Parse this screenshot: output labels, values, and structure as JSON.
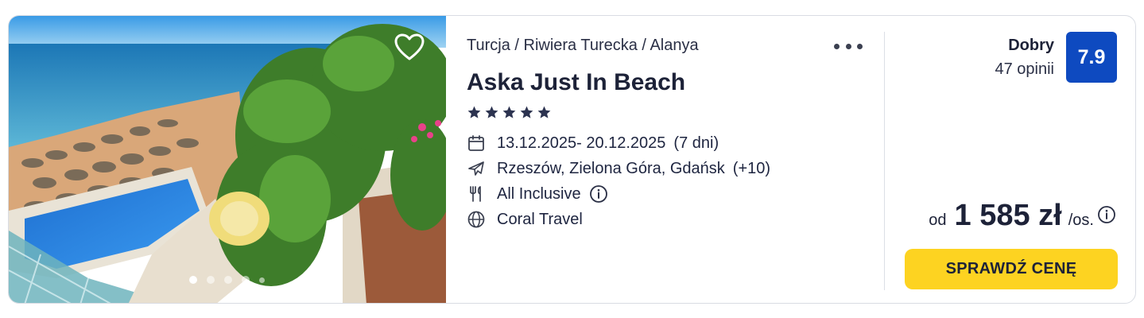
{
  "listing": {
    "breadcrumb": "Turcja / Riwiera Turecka / Alanya",
    "hotel_name": "Aska Just In Beach",
    "star_rating": 5,
    "dates": "13.12.2025- 20.12.2025",
    "duration": "(7 dni)",
    "departure_airports": "Rzeszów, Zielona Góra, Gdańsk",
    "departure_more": "(+10)",
    "board": "All Inclusive",
    "operator": "Coral Travel",
    "photo_count": 5,
    "active_photo_index": 0,
    "icons": [
      "heart-icon",
      "more-dots-icon",
      "star-icon",
      "calendar-icon",
      "plane-icon",
      "cutlery-icon",
      "info-icon",
      "globe-icon"
    ]
  },
  "rating": {
    "label": "Dobry",
    "reviews": "47 opinii",
    "score": "7.9",
    "badge_color": "#0e4ac0"
  },
  "price": {
    "prefix": "od",
    "amount": "1 585 zł",
    "suffix": "/os."
  },
  "cta": {
    "label": "SPRAWDŹ CENĘ",
    "color": "#fdd321"
  }
}
